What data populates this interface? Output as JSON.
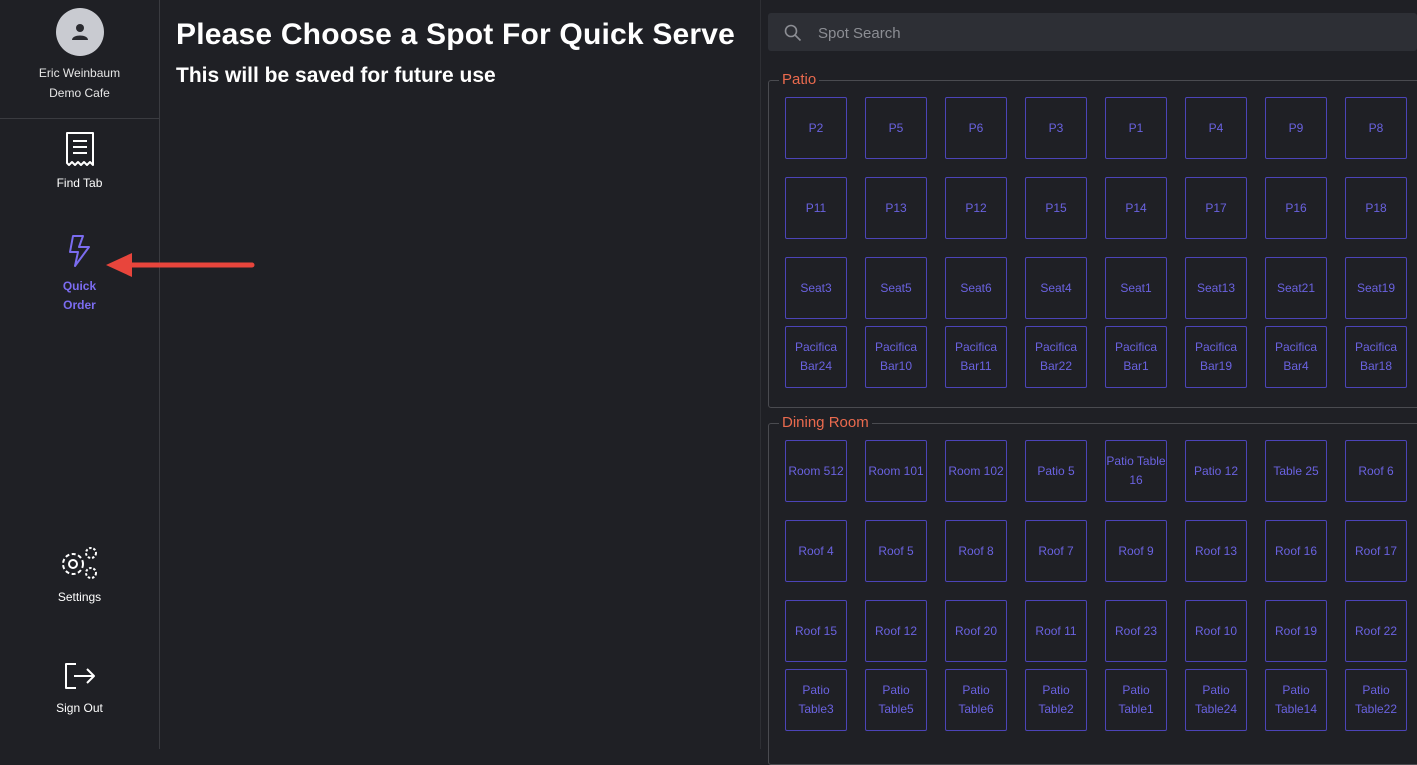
{
  "user": {
    "name": "Eric Weinbaum",
    "cafe": "Demo Cafe"
  },
  "nav": {
    "find_tab": "Find Tab",
    "quick_order": "Quick Order",
    "settings": "Settings",
    "sign_out": "Sign Out"
  },
  "header": {
    "title": "Please Choose a Spot For Quick Serve",
    "subtitle": "This will be saved for future use"
  },
  "search": {
    "placeholder": "Spot Search"
  },
  "colors": {
    "accent": "#6a62e0",
    "section_title": "#ea6a4e",
    "background": "#1f2025",
    "arrow": "#e8453c"
  },
  "sections": [
    {
      "title": "Patio",
      "spots": [
        "P2",
        "P5",
        "P6",
        "P3",
        "P1",
        "P4",
        "P9",
        "P8",
        "P11",
        "P13",
        "P12",
        "P15",
        "P14",
        "P17",
        "P16",
        "P18",
        "Seat3",
        "Seat5",
        "Seat6",
        "Seat4",
        "Seat1",
        "Seat13",
        "Seat21",
        "Seat19",
        "Pacifica Bar24",
        "Pacifica Bar10",
        "Pacifica Bar11",
        "Pacifica Bar22",
        "Pacifica Bar1",
        "Pacifica Bar19",
        "Pacifica Bar4",
        "Pacifica Bar18"
      ]
    },
    {
      "title": "Dining Room",
      "spots": [
        "Room 512",
        "Room 101",
        "Room 102",
        "Patio 5",
        "Patio Table 16",
        "Patio 12",
        "Table 25",
        "Roof 6",
        "Roof 4",
        "Roof 5",
        "Roof 8",
        "Roof 7",
        "Roof 9",
        "Roof 13",
        "Roof 16",
        "Roof 17",
        "Roof 15",
        "Roof 12",
        "Roof 20",
        "Roof 11",
        "Roof 23",
        "Roof 10",
        "Roof 19",
        "Roof 22",
        "Patio Table3",
        "Patio Table5",
        "Patio Table6",
        "Patio Table2",
        "Patio Table1",
        "Patio Table24",
        "Patio Table14",
        "Patio Table22"
      ]
    }
  ]
}
